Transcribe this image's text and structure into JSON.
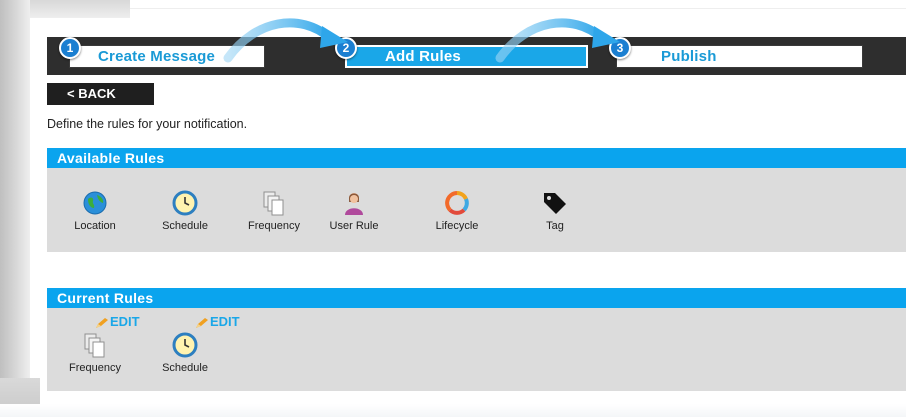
{
  "wizard": {
    "steps": [
      {
        "number": "1",
        "label": "Create Message"
      },
      {
        "number": "2",
        "label": "Add Rules"
      },
      {
        "number": "3",
        "label": "Publish"
      }
    ],
    "active_step": 2
  },
  "back_button": {
    "label": "< BACK"
  },
  "intro_text": "Define the rules for your notification.",
  "available_rules": {
    "title": "Available Rules",
    "items": [
      {
        "label": "Location",
        "icon": "globe-icon"
      },
      {
        "label": "Schedule",
        "icon": "clock-icon"
      },
      {
        "label": "Frequency",
        "icon": "pages-icon"
      },
      {
        "label": "User Rule",
        "icon": "user-icon"
      },
      {
        "label": "Lifecycle",
        "icon": "cycle-icon"
      },
      {
        "label": "Tag",
        "icon": "tag-icon"
      }
    ]
  },
  "current_rules": {
    "title": "Current Rules",
    "items": [
      {
        "label": "Frequency",
        "icon": "pages-icon",
        "edit_label": "EDIT"
      },
      {
        "label": "Schedule",
        "icon": "clock-icon",
        "edit_label": "EDIT"
      }
    ]
  },
  "colors": {
    "accent": "#0aa4ee",
    "wizard_bg": "#2e2e2e",
    "panel_bg": "#dcdcdc",
    "step_number_bg": "#1b7fd1"
  }
}
